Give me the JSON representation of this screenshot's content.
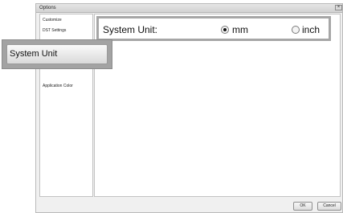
{
  "window": {
    "title": "Options",
    "close_glyph": "×"
  },
  "sidebar": {
    "items": [
      {
        "label": "Customize"
      },
      {
        "label": "DST Settings"
      },
      {
        "label": "Application Color"
      }
    ]
  },
  "main": {
    "system_unit": {
      "label": "System Unit:",
      "options": [
        {
          "label": "mm",
          "selected": true
        },
        {
          "label": "inch",
          "selected": false
        }
      ]
    }
  },
  "footer": {
    "ok_label": "OK",
    "cancel_label": "Cancel"
  },
  "callout": {
    "label": "System Unit"
  }
}
